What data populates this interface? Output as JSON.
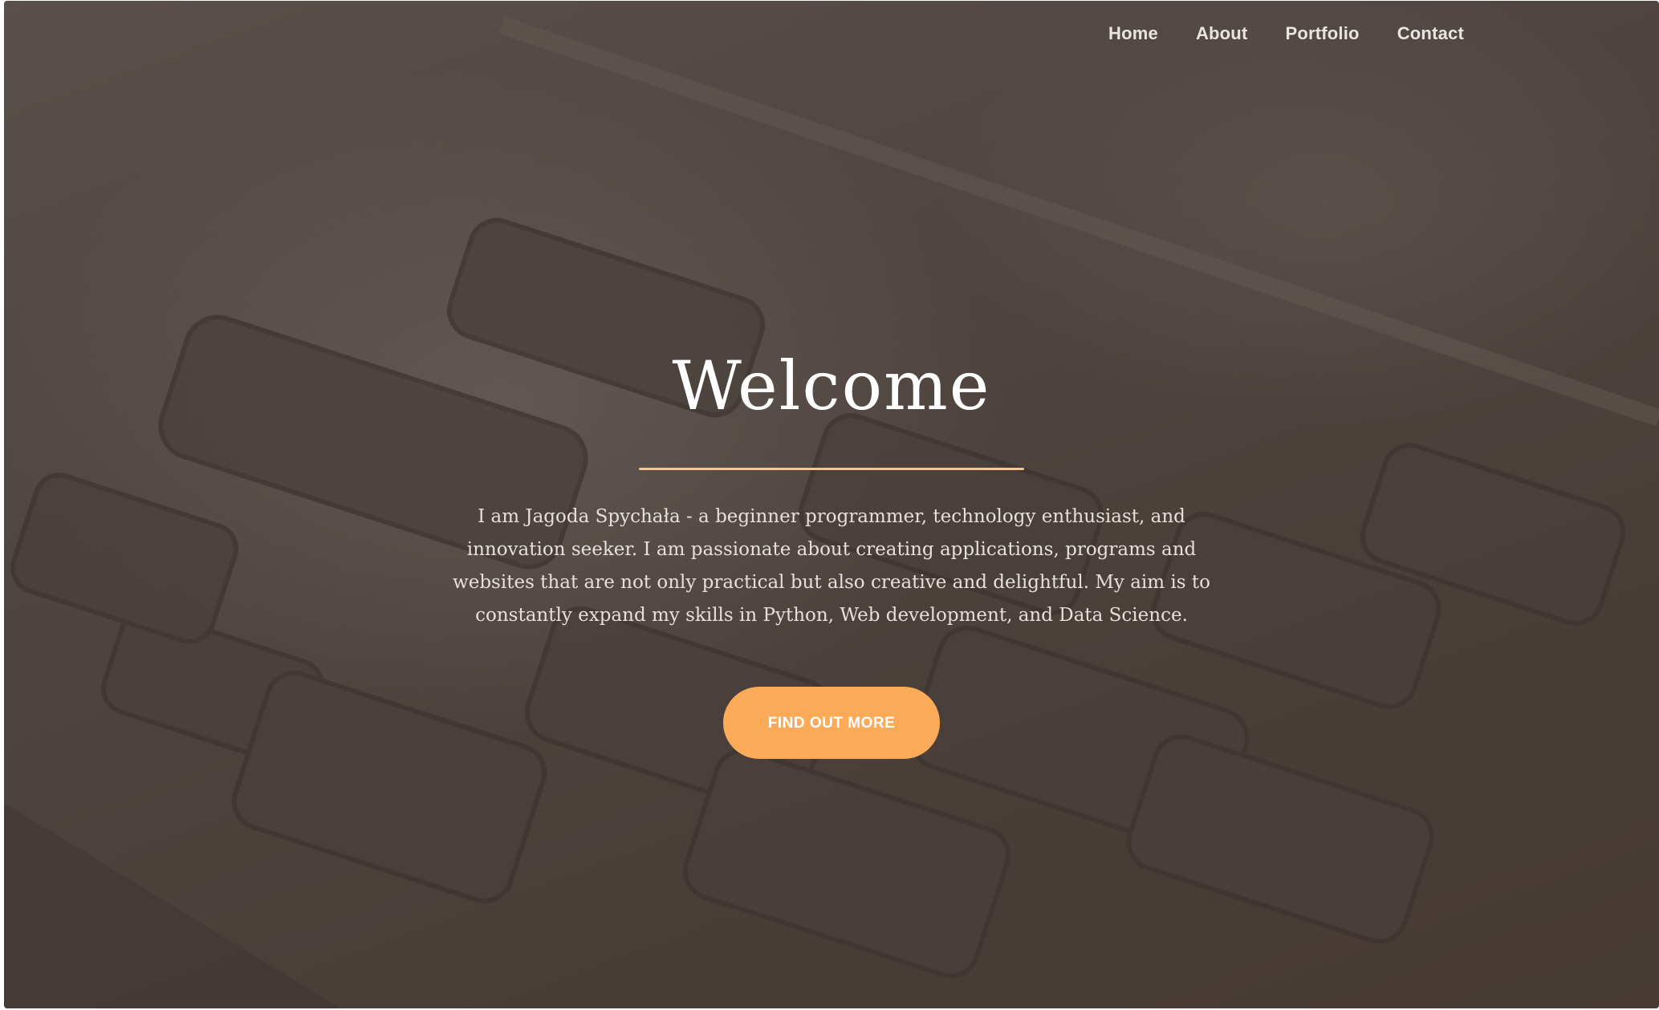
{
  "nav": {
    "items": [
      {
        "label": "Home"
      },
      {
        "label": "About"
      },
      {
        "label": "Portfolio"
      },
      {
        "label": "Contact"
      }
    ]
  },
  "hero": {
    "title": "Welcome",
    "intro": "I am Jagoda Spychała - a beginner programmer, technology enthusiast, and innovation seeker. I am passionate about creating applications, programs and websites that are not only practical but also creative and delightful. My aim is to constantly expand my skills in Python, Web development, and Data Science.",
    "cta_label": "FIND OUT MORE"
  },
  "colors": {
    "accent": "#fbaa57",
    "divider": "#f5c59a",
    "overlay": "#4a3f38"
  }
}
